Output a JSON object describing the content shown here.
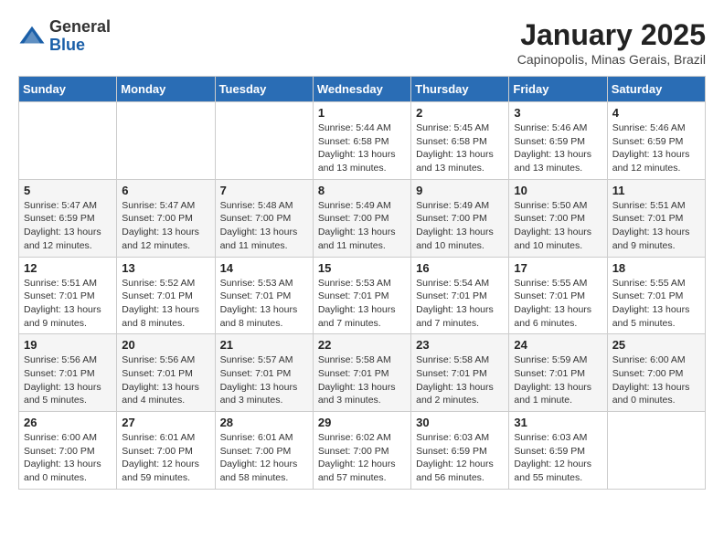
{
  "logo": {
    "general": "General",
    "blue": "Blue"
  },
  "title": "January 2025",
  "subtitle": "Capinopolis, Minas Gerais, Brazil",
  "days_of_week": [
    "Sunday",
    "Monday",
    "Tuesday",
    "Wednesday",
    "Thursday",
    "Friday",
    "Saturday"
  ],
  "weeks": [
    [
      {
        "day": "",
        "info": ""
      },
      {
        "day": "",
        "info": ""
      },
      {
        "day": "",
        "info": ""
      },
      {
        "day": "1",
        "info": "Sunrise: 5:44 AM\nSunset: 6:58 PM\nDaylight: 13 hours\nand 13 minutes."
      },
      {
        "day": "2",
        "info": "Sunrise: 5:45 AM\nSunset: 6:58 PM\nDaylight: 13 hours\nand 13 minutes."
      },
      {
        "day": "3",
        "info": "Sunrise: 5:46 AM\nSunset: 6:59 PM\nDaylight: 13 hours\nand 13 minutes."
      },
      {
        "day": "4",
        "info": "Sunrise: 5:46 AM\nSunset: 6:59 PM\nDaylight: 13 hours\nand 12 minutes."
      }
    ],
    [
      {
        "day": "5",
        "info": "Sunrise: 5:47 AM\nSunset: 6:59 PM\nDaylight: 13 hours\nand 12 minutes."
      },
      {
        "day": "6",
        "info": "Sunrise: 5:47 AM\nSunset: 7:00 PM\nDaylight: 13 hours\nand 12 minutes."
      },
      {
        "day": "7",
        "info": "Sunrise: 5:48 AM\nSunset: 7:00 PM\nDaylight: 13 hours\nand 11 minutes."
      },
      {
        "day": "8",
        "info": "Sunrise: 5:49 AM\nSunset: 7:00 PM\nDaylight: 13 hours\nand 11 minutes."
      },
      {
        "day": "9",
        "info": "Sunrise: 5:49 AM\nSunset: 7:00 PM\nDaylight: 13 hours\nand 10 minutes."
      },
      {
        "day": "10",
        "info": "Sunrise: 5:50 AM\nSunset: 7:00 PM\nDaylight: 13 hours\nand 10 minutes."
      },
      {
        "day": "11",
        "info": "Sunrise: 5:51 AM\nSunset: 7:01 PM\nDaylight: 13 hours\nand 9 minutes."
      }
    ],
    [
      {
        "day": "12",
        "info": "Sunrise: 5:51 AM\nSunset: 7:01 PM\nDaylight: 13 hours\nand 9 minutes."
      },
      {
        "day": "13",
        "info": "Sunrise: 5:52 AM\nSunset: 7:01 PM\nDaylight: 13 hours\nand 8 minutes."
      },
      {
        "day": "14",
        "info": "Sunrise: 5:53 AM\nSunset: 7:01 PM\nDaylight: 13 hours\nand 8 minutes."
      },
      {
        "day": "15",
        "info": "Sunrise: 5:53 AM\nSunset: 7:01 PM\nDaylight: 13 hours\nand 7 minutes."
      },
      {
        "day": "16",
        "info": "Sunrise: 5:54 AM\nSunset: 7:01 PM\nDaylight: 13 hours\nand 7 minutes."
      },
      {
        "day": "17",
        "info": "Sunrise: 5:55 AM\nSunset: 7:01 PM\nDaylight: 13 hours\nand 6 minutes."
      },
      {
        "day": "18",
        "info": "Sunrise: 5:55 AM\nSunset: 7:01 PM\nDaylight: 13 hours\nand 5 minutes."
      }
    ],
    [
      {
        "day": "19",
        "info": "Sunrise: 5:56 AM\nSunset: 7:01 PM\nDaylight: 13 hours\nand 5 minutes."
      },
      {
        "day": "20",
        "info": "Sunrise: 5:56 AM\nSunset: 7:01 PM\nDaylight: 13 hours\nand 4 minutes."
      },
      {
        "day": "21",
        "info": "Sunrise: 5:57 AM\nSunset: 7:01 PM\nDaylight: 13 hours\nand 3 minutes."
      },
      {
        "day": "22",
        "info": "Sunrise: 5:58 AM\nSunset: 7:01 PM\nDaylight: 13 hours\nand 3 minutes."
      },
      {
        "day": "23",
        "info": "Sunrise: 5:58 AM\nSunset: 7:01 PM\nDaylight: 13 hours\nand 2 minutes."
      },
      {
        "day": "24",
        "info": "Sunrise: 5:59 AM\nSunset: 7:01 PM\nDaylight: 13 hours\nand 1 minute."
      },
      {
        "day": "25",
        "info": "Sunrise: 6:00 AM\nSunset: 7:00 PM\nDaylight: 13 hours\nand 0 minutes."
      }
    ],
    [
      {
        "day": "26",
        "info": "Sunrise: 6:00 AM\nSunset: 7:00 PM\nDaylight: 13 hours\nand 0 minutes."
      },
      {
        "day": "27",
        "info": "Sunrise: 6:01 AM\nSunset: 7:00 PM\nDaylight: 12 hours\nand 59 minutes."
      },
      {
        "day": "28",
        "info": "Sunrise: 6:01 AM\nSunset: 7:00 PM\nDaylight: 12 hours\nand 58 minutes."
      },
      {
        "day": "29",
        "info": "Sunrise: 6:02 AM\nSunset: 7:00 PM\nDaylight: 12 hours\nand 57 minutes."
      },
      {
        "day": "30",
        "info": "Sunrise: 6:03 AM\nSunset: 6:59 PM\nDaylight: 12 hours\nand 56 minutes."
      },
      {
        "day": "31",
        "info": "Sunrise: 6:03 AM\nSunset: 6:59 PM\nDaylight: 12 hours\nand 55 minutes."
      },
      {
        "day": "",
        "info": ""
      }
    ]
  ]
}
